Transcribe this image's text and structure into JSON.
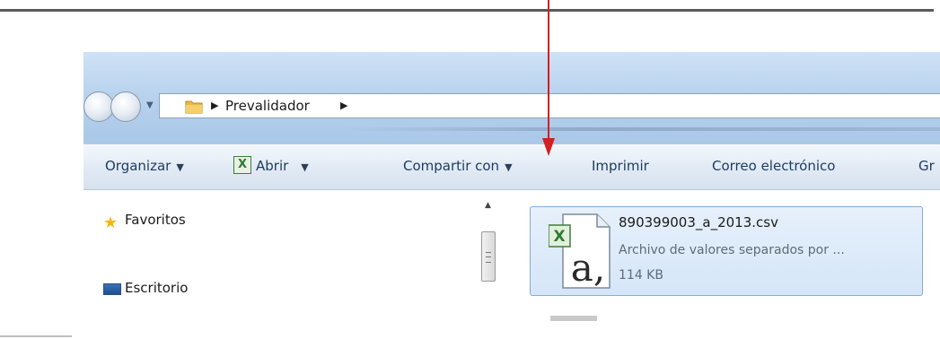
{
  "explorer": {
    "breadcrumb": {
      "folder": "Prevalidador"
    },
    "toolbar": {
      "organize": "Organizar",
      "open": "Abrir",
      "share": "Compartir con",
      "print": "Imprimir",
      "email": "Correo electrónico",
      "burn": "Gr"
    },
    "nav_pane": {
      "favorites": "Favoritos",
      "desktop": "Escritorio"
    },
    "file": {
      "name": "890399003_a_2013.csv",
      "type": "Archivo de valores separados por ...",
      "size": "114 KB",
      "icon_glyph": "a,",
      "excel_badge": "X"
    }
  },
  "colors": {
    "annotation_arrow": "#d32020",
    "selection_fill": "#d9e8f9",
    "selection_border": "#84acdd",
    "toolbar_text": "#1e3a5f"
  },
  "icons": [
    "back-icon",
    "forward-icon",
    "folder-icon",
    "excel-icon",
    "star-icon",
    "desktop-icon",
    "csv-file-icon"
  ]
}
